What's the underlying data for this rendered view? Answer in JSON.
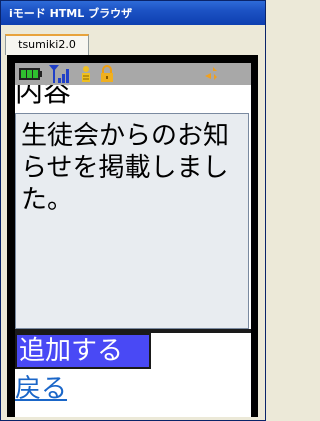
{
  "window": {
    "title": "iモード HTML ブラウザ"
  },
  "tab": {
    "label": "tsumiki2.0"
  },
  "status_bar": {
    "icons": [
      "battery-icon",
      "signal-antenna-icon",
      "memory-icon",
      "lock-icon",
      "direction-arrows-icon"
    ]
  },
  "content": {
    "heading": "内容",
    "body_text": "生徒会からのお知らせを掲載しました。",
    "add_button_label": "追加する",
    "back_link_label": "戻る"
  },
  "colors": {
    "add_button_bg": "#4949f5",
    "link": "#1a66c8",
    "textarea_bg": "#e8ecf0",
    "status_bar_bg": "#a8a8a8"
  }
}
